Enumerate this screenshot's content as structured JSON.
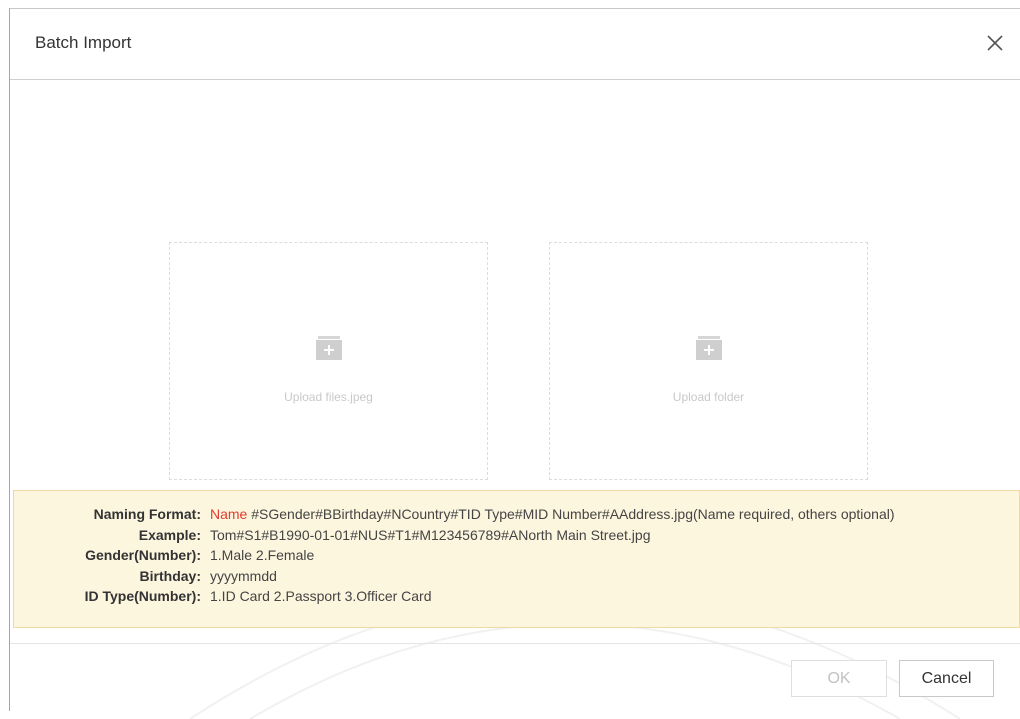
{
  "dialog": {
    "title": "Batch Import",
    "close_icon": "close-icon"
  },
  "upload": {
    "files_label": "Upload files.jpeg",
    "folder_label": "Upload folder",
    "icon": "folder-plus-icon"
  },
  "naming": {
    "rows": [
      {
        "key": "Naming Format:",
        "required": "Name",
        "value": " #SGender#BBirthday#NCountry#TID Type#MID Number#AAddress.jpg(Name required, others optional)"
      },
      {
        "key": "Example:",
        "value": "Tom#S1#B1990-01-01#NUS#T1#M123456789#ANorth Main Street.jpg"
      },
      {
        "key": "Gender(Number):",
        "value": "1.Male 2.Female"
      },
      {
        "key": "Birthday:",
        "value": "yyyymmdd"
      },
      {
        "key": "ID Type(Number):",
        "value": "1.ID Card  2.Passport  3.Officer Card"
      }
    ]
  },
  "footer": {
    "ok_label": "OK",
    "cancel_label": "Cancel"
  },
  "colors": {
    "required": "#e23b2e",
    "panel_bg": "#fdf6df",
    "panel_border": "#f1d9a6"
  }
}
